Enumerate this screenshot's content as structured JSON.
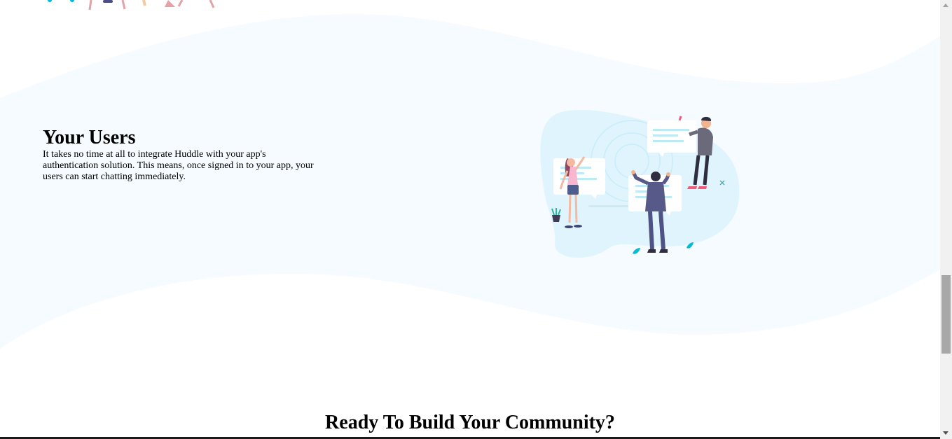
{
  "features": {
    "users": {
      "title": "Your Users",
      "text": "It takes no time at all to integrate Huddle with your app's authentication solution. This means, once signed in to your app, your users can start chatting immediately.",
      "illustration": "illustration-your-users"
    }
  },
  "cta": {
    "title": "Ready To Build Your Community?"
  },
  "colors": {
    "wave": "#f5fbff",
    "blob": "#e0f4fd",
    "accent": "#00bcd4"
  }
}
